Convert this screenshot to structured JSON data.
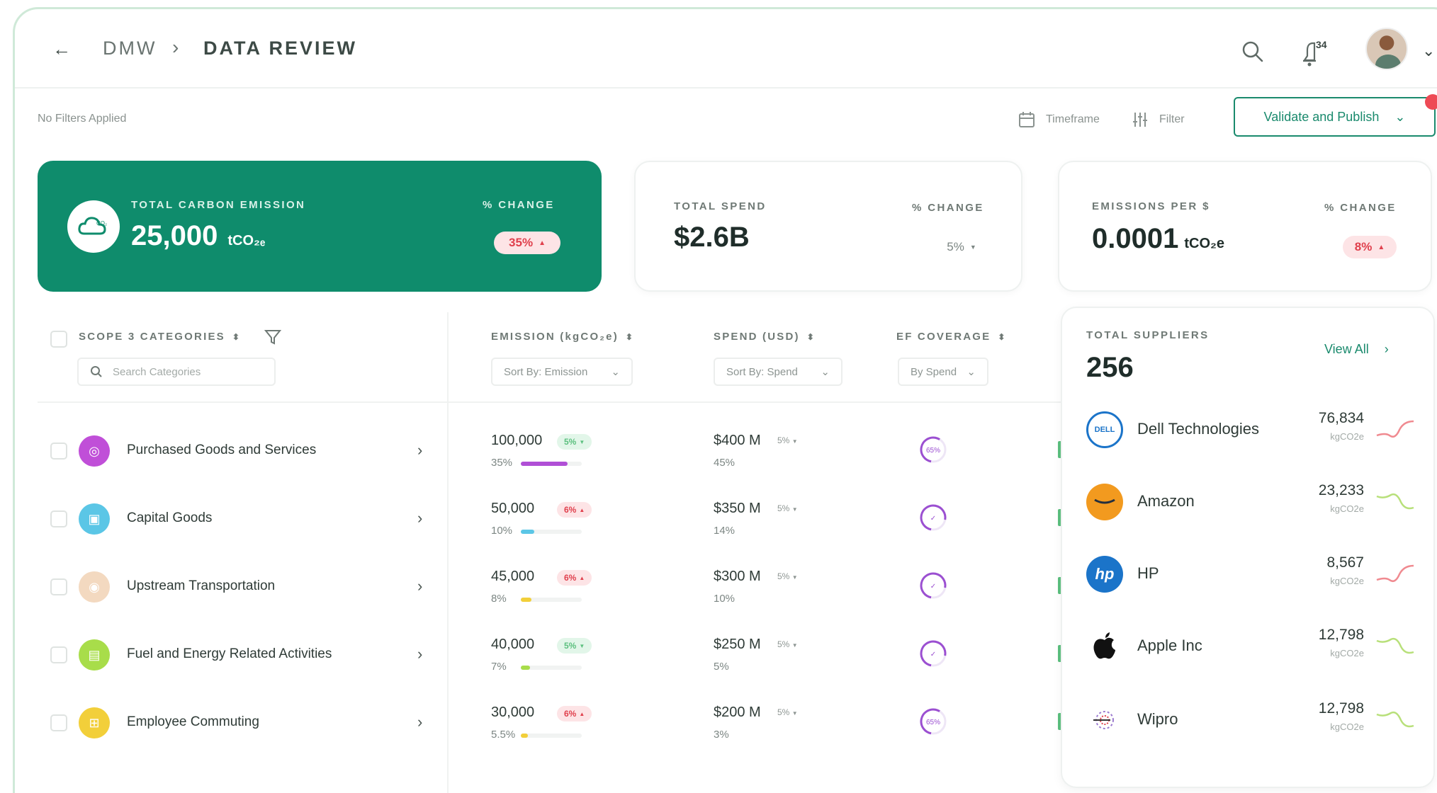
{
  "header": {
    "breadcrumb_root": "DMW",
    "breadcrumb_sep": "›",
    "page_title": "DATA REVIEW",
    "notifications": "34"
  },
  "toolbar": {
    "filters_status": "No Filters Applied",
    "timeframe_label": "Timeframe",
    "filter_label": "Filter",
    "publish_label": "Validate and Publish"
  },
  "kpis": {
    "carbon": {
      "label": "TOTAL CARBON EMISSION",
      "value": "25,000",
      "unit": "tCO₂ₑ",
      "change_label": "% CHANGE",
      "change": "35%"
    },
    "spend": {
      "label": "TOTAL SPEND",
      "value": "$2.6B",
      "change_label": "% CHANGE",
      "change": "5%"
    },
    "eps": {
      "label": "EMISSIONS PER $",
      "value": "0.0001",
      "unit": "tCO₂e",
      "change_label": "% CHANGE",
      "change": "8%"
    }
  },
  "table": {
    "headers": {
      "categories": "SCOPE 3 CATEGORIES",
      "emission": "EMISSION (kgCO₂e)",
      "spend": "SPEND (USD)",
      "ef": "EF COVERAGE"
    },
    "search_placeholder": "Search Categories",
    "sort_emission": "Sort By: Emission",
    "sort_spend": "Sort By: Spend",
    "sort_ef": "By Spend",
    "rows": [
      {
        "name": "Purchased Goods and Services",
        "emission": "100,000",
        "em_change": "5%",
        "em_dir": "down",
        "em_pct": "35%",
        "em_share": 0.35,
        "spend": "$400 M",
        "sp_change": "5%",
        "sp_pct": "45%",
        "ef": "65%",
        "ef_kind": "percent",
        "icon_color": "#c04fd8"
      },
      {
        "name": "Capital Goods",
        "emission": "50,000",
        "em_change": "6%",
        "em_dir": "up",
        "em_pct": "10%",
        "em_share": 0.1,
        "spend": "$350 M",
        "sp_change": "5%",
        "sp_pct": "14%",
        "ef": "✓",
        "ef_kind": "check",
        "icon_color": "#5bc6e6"
      },
      {
        "name": "Upstream Transportation",
        "emission": "45,000",
        "em_change": "6%",
        "em_dir": "up",
        "em_pct": "8%",
        "em_share": 0.08,
        "spend": "$300 M",
        "sp_change": "5%",
        "sp_pct": "10%",
        "ef": "✓",
        "ef_kind": "check",
        "icon_color": "#f3d9c0"
      },
      {
        "name": "Fuel and Energy Related Activities",
        "emission": "40,000",
        "em_change": "5%",
        "em_dir": "down",
        "em_pct": "7%",
        "em_share": 0.07,
        "spend": "$250 M",
        "sp_change": "5%",
        "sp_pct": "5%",
        "ef": "✓",
        "ef_kind": "check",
        "icon_color": "#a8dd4a"
      },
      {
        "name": "Employee Commuting",
        "emission": "30,000",
        "em_change": "6%",
        "em_dir": "up",
        "em_pct": "5.5%",
        "em_share": 0.055,
        "spend": "$200 M",
        "sp_change": "5%",
        "sp_pct": "3%",
        "ef": "65%",
        "ef_kind": "percent",
        "icon_color": "#f2cf3a"
      }
    ]
  },
  "suppliers": {
    "label": "TOTAL SUPPLIERS",
    "count": "256",
    "view_all": "View All",
    "items": [
      {
        "name": "Dell Technologies",
        "value": "76,834",
        "unit": "kgCO2e",
        "trend": "up",
        "logo": "dell-logo"
      },
      {
        "name": "Amazon",
        "value": "23,233",
        "unit": "kgCO2e",
        "trend": "down",
        "logo": "amazon-logo"
      },
      {
        "name": "HP",
        "value": "8,567",
        "unit": "kgCO2e",
        "trend": "up",
        "logo": "hp-logo"
      },
      {
        "name": "Apple Inc",
        "value": "12,798",
        "unit": "kgCO2e",
        "trend": "down",
        "logo": "apple-logo"
      },
      {
        "name": "Wipro",
        "value": "12,798",
        "unit": "kgCO2e",
        "trend": "down",
        "logo": "wipro-logo"
      }
    ]
  },
  "colors": {
    "brand": "#0f8c6c",
    "accent_text": "#1a8a6d",
    "negative": "#e0404d",
    "positive": "#5cc07f",
    "ef_ring": "#9b4fd1"
  }
}
